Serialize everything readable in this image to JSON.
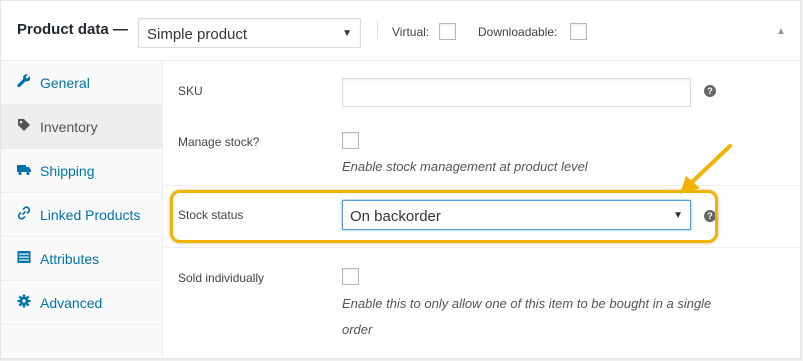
{
  "header": {
    "title": "Product data —",
    "product_type": "Simple product",
    "virtual_label": "Virtual:",
    "downloadable_label": "Downloadable:"
  },
  "sidebar": {
    "items": [
      {
        "label": "General",
        "icon": "wrench-icon"
      },
      {
        "label": "Inventory",
        "icon": "tag-icon",
        "active": true
      },
      {
        "label": "Shipping",
        "icon": "truck-icon"
      },
      {
        "label": "Linked Products",
        "icon": "link-icon"
      },
      {
        "label": "Attributes",
        "icon": "list-icon"
      },
      {
        "label": "Advanced",
        "icon": "gear-icon"
      }
    ]
  },
  "inventory": {
    "sku_label": "SKU",
    "sku_value": "",
    "manage_stock_label": "Manage stock?",
    "manage_stock_desc": "Enable stock management at product level",
    "stock_status_label": "Stock status",
    "stock_status_value": "On backorder",
    "sold_individually_label": "Sold individually",
    "sold_individually_desc_line1": "Enable this to only allow one of this item to be bought in a single",
    "sold_individually_desc_line2": "order",
    "help_glyph": "?"
  },
  "colors": {
    "link": "#0073aa",
    "highlight": "#f0b400",
    "focus": "#5b9dd9"
  }
}
